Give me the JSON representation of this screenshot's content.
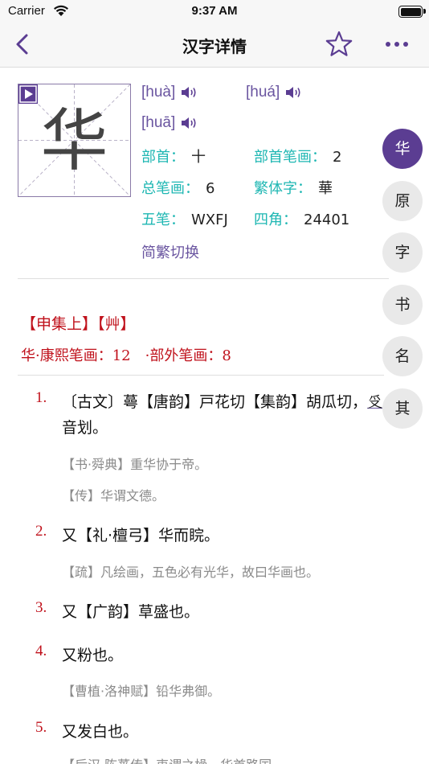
{
  "status": {
    "carrier": "Carrier",
    "time": "9:37 AM"
  },
  "nav": {
    "title": "汉字详情"
  },
  "character": {
    "glyph": "华"
  },
  "pinyin": [
    "[huà]",
    "[huá]",
    "[huā]"
  ],
  "info": {
    "radical_label": "部首：",
    "radical": "十",
    "radical_strokes_label": "部首笔画：",
    "radical_strokes": "2",
    "total_strokes_label": "总笔画：",
    "total_strokes": "6",
    "traditional_label": "繁体字：",
    "traditional": "華",
    "wubi_label": "五笔：",
    "wubi": "WXFJ",
    "sijiao_label": "四角：",
    "sijiao": "24401",
    "toggle": "简繁切换"
  },
  "kangxi": {
    "volume": "【申集上】【艸】",
    "strokes": "华·康熙笔画：12　·部外笔画：8"
  },
  "definitions": [
    {
      "num": "1.",
      "text_a": "〔古文〕蕚【唐韵】戸花切【集韵】胡瓜切，",
      "text_mark": "𠬪",
      "text_b": "音划。"
    },
    {
      "num": "2.",
      "text": "又【礼·檀弓】华而睆。"
    },
    {
      "num": "3.",
      "text": "又【广韵】草盛也。"
    },
    {
      "num": "4.",
      "text": "又粉也。"
    },
    {
      "num": "5.",
      "text": "又发白也。"
    }
  ],
  "quotes": {
    "q1a": "【书·舜典】重华协于帝。",
    "q1b": "【传】华谓文德。",
    "q2": "【疏】凡绘画，五色必有光华，故曰华画也。",
    "q4": "【曹植·洛神赋】铅华弗御。",
    "q5": "【后汉·陈蕃传】衷谓之橾，华首路国"
  },
  "side_index": [
    "华",
    "原",
    "字",
    "书",
    "名",
    "其"
  ],
  "colors": {
    "accent": "#5b3d92",
    "teal": "#1fb7b3",
    "red": "#c0121c"
  }
}
